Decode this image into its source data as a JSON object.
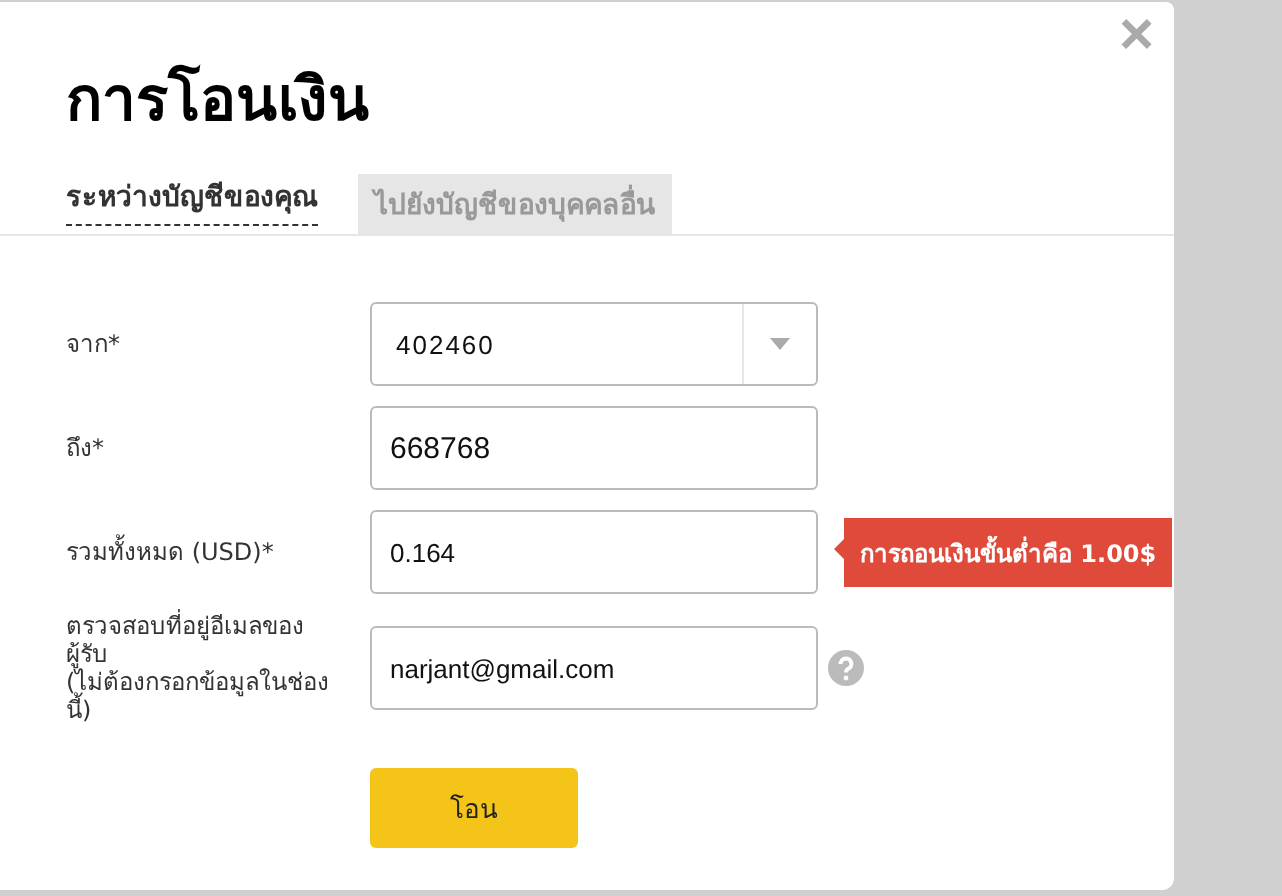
{
  "dialog": {
    "title": "การโอนเงิน",
    "close": "×"
  },
  "tabs": [
    {
      "label": "ระหว่างบัญชีของคุณ",
      "selected": true
    },
    {
      "label": "ไปยังบัญชีของบุคคลอื่น",
      "selected": false
    }
  ],
  "fields": [
    {
      "kind": "select",
      "label": "จาก*",
      "value": "402460"
    },
    {
      "kind": "input",
      "label": "ถึง*",
      "value": "668768",
      "large": true
    },
    {
      "kind": "input",
      "label": "รวมทั้งหมด (USD)*",
      "value": "0.164",
      "large": false,
      "error": "การถอนเงินขั้นต่ำคือ 1.00$"
    },
    {
      "kind": "input",
      "label": "ตรวจสอบที่อยู่อีเมลของผู้รับ",
      "note": "(ไม่ต้องกรอกข้อมูลในช่องนี้)",
      "value": "narjant@gmail.com",
      "large": false,
      "help": true
    }
  ],
  "submit": "โอน"
}
